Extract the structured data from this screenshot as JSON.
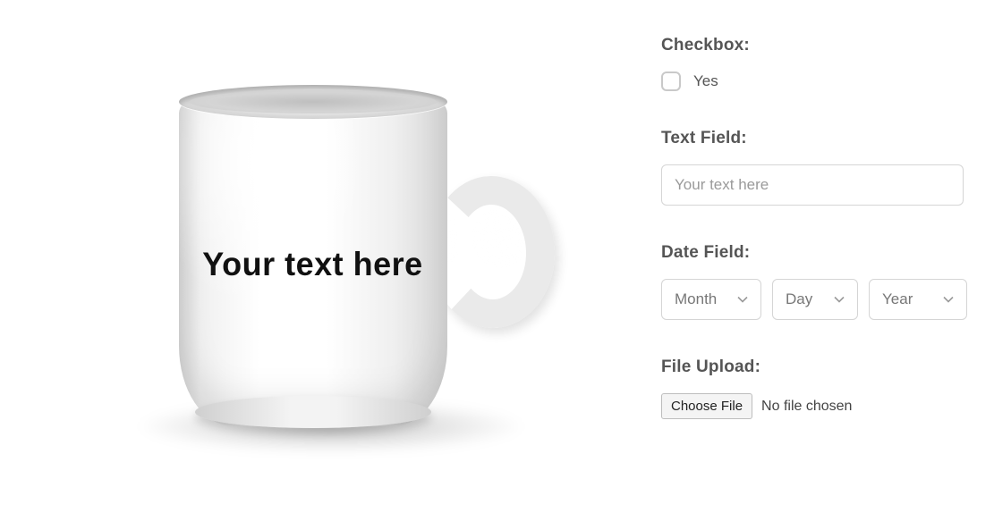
{
  "product": {
    "preview_text": "Your text here"
  },
  "form": {
    "checkbox": {
      "label": "Checkbox:",
      "option_label": "Yes",
      "checked": false
    },
    "text_field": {
      "label": "Text Field:",
      "placeholder": "Your text here",
      "value": ""
    },
    "date_field": {
      "label": "Date Field:",
      "month_placeholder": "Month",
      "day_placeholder": "Day",
      "year_placeholder": "Year"
    },
    "file_upload": {
      "label": "File Upload:",
      "button_label": "Choose File",
      "status_text": "No file chosen"
    }
  }
}
